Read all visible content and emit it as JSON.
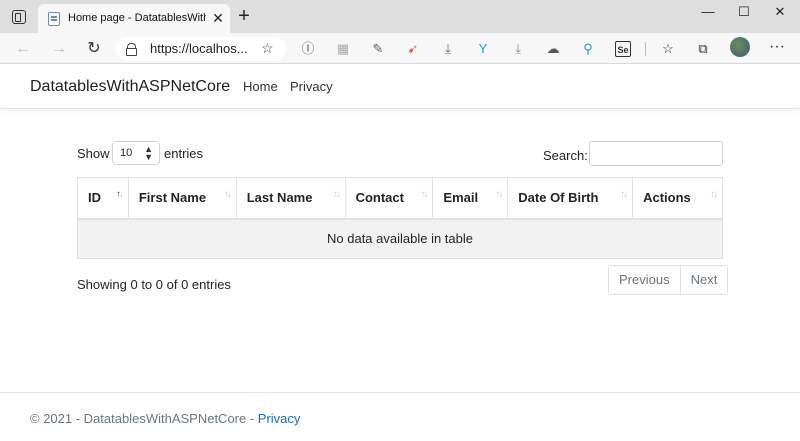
{
  "browser": {
    "tab_title": "Home page - DatatablesWithASP",
    "tab_close": "✕",
    "new_tab": "+",
    "url": "https://localhos...",
    "window_controls": {
      "minimize": "—",
      "maximize": "☐",
      "close": "✕"
    },
    "nav": {
      "back": "←",
      "forward": "→",
      "refresh": "↻"
    },
    "extensions": [
      {
        "name": "reader-icon",
        "glyph": "Ⓘ",
        "color": "#555"
      },
      {
        "name": "split-icon",
        "glyph": "▦",
        "color": "#aaa"
      },
      {
        "name": "pen-icon",
        "glyph": "✎",
        "color": "#666"
      },
      {
        "name": "swift-icon",
        "glyph": "➹",
        "color": "#f05a28"
      },
      {
        "name": "download-icon",
        "glyph": "⤓",
        "color": "#666"
      },
      {
        "name": "fork-icon",
        "glyph": "Y",
        "color": "#1aa3b5"
      },
      {
        "name": "download-alt-icon",
        "glyph": "⤓",
        "color": "#888"
      },
      {
        "name": "cloud-icon",
        "glyph": "☁",
        "color": "#555"
      },
      {
        "name": "magnifier-icon",
        "glyph": "⚲",
        "color": "#2c8fc9"
      },
      {
        "name": "selenium-icon",
        "glyph": "Se",
        "color": "#333"
      },
      {
        "name": "favorites-icon",
        "glyph": "☆",
        "color": "#333"
      },
      {
        "name": "collections-icon",
        "glyph": "⧉",
        "color": "#333"
      }
    ],
    "more": "···"
  },
  "navbar": {
    "brand": "DatatablesWithASPNetCore",
    "links": [
      "Home",
      "Privacy"
    ]
  },
  "datatable": {
    "show_label": "Show",
    "entries_label": "entries",
    "page_length": "10",
    "search_label": "Search:",
    "search_value": "",
    "columns": [
      "ID",
      "First Name",
      "Last Name",
      "Contact",
      "Email",
      "Date Of Birth",
      "Actions"
    ],
    "empty_message": "No data available in table",
    "info": "Showing 0 to 0 of 0 entries",
    "pagination": {
      "previous": "Previous",
      "next": "Next"
    }
  },
  "footer": {
    "copyright": "© 2021 - DatatablesWithASPNetCore - ",
    "privacy_link": "Privacy"
  }
}
